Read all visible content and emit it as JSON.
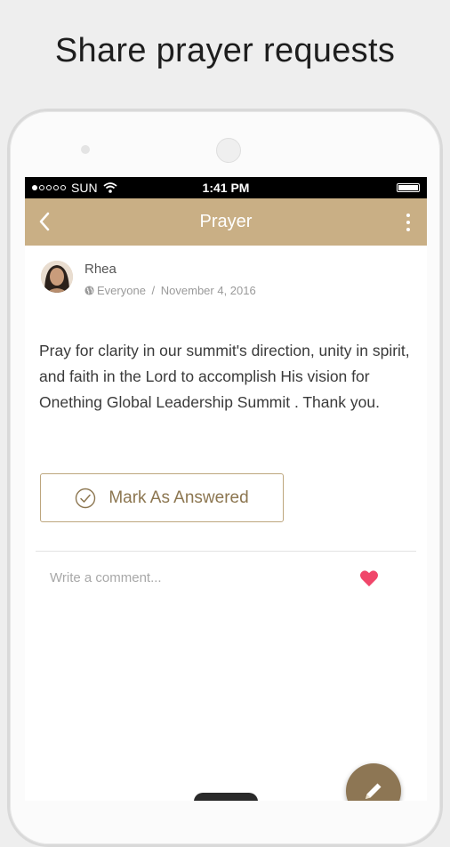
{
  "headline": "Share prayer requests",
  "status_bar": {
    "carrier": "SUN",
    "time": "1:41 PM"
  },
  "app_bar": {
    "title": "Prayer"
  },
  "post": {
    "author": "Rhea",
    "audience": "Everyone",
    "date": "November 4, 2016",
    "meta_separator": " / ",
    "body": "Pray for clarity in our summit's direction, unity in spirit, and faith in the Lord to accomplish His vision for Onething Global Leadership Summit . Thank you.",
    "answer_button_label": "Mark As Answered"
  },
  "comment": {
    "placeholder": "Write a comment..."
  },
  "colors": {
    "accent": "#c9af85",
    "accent_dark": "#8d7654",
    "heart": "#f0466a"
  },
  "icons": [
    "back-arrow-icon",
    "more-vertical-icon",
    "globe-icon",
    "check-circle-icon",
    "heart-icon",
    "pencil-icon",
    "wifi-icon",
    "battery-icon"
  ]
}
